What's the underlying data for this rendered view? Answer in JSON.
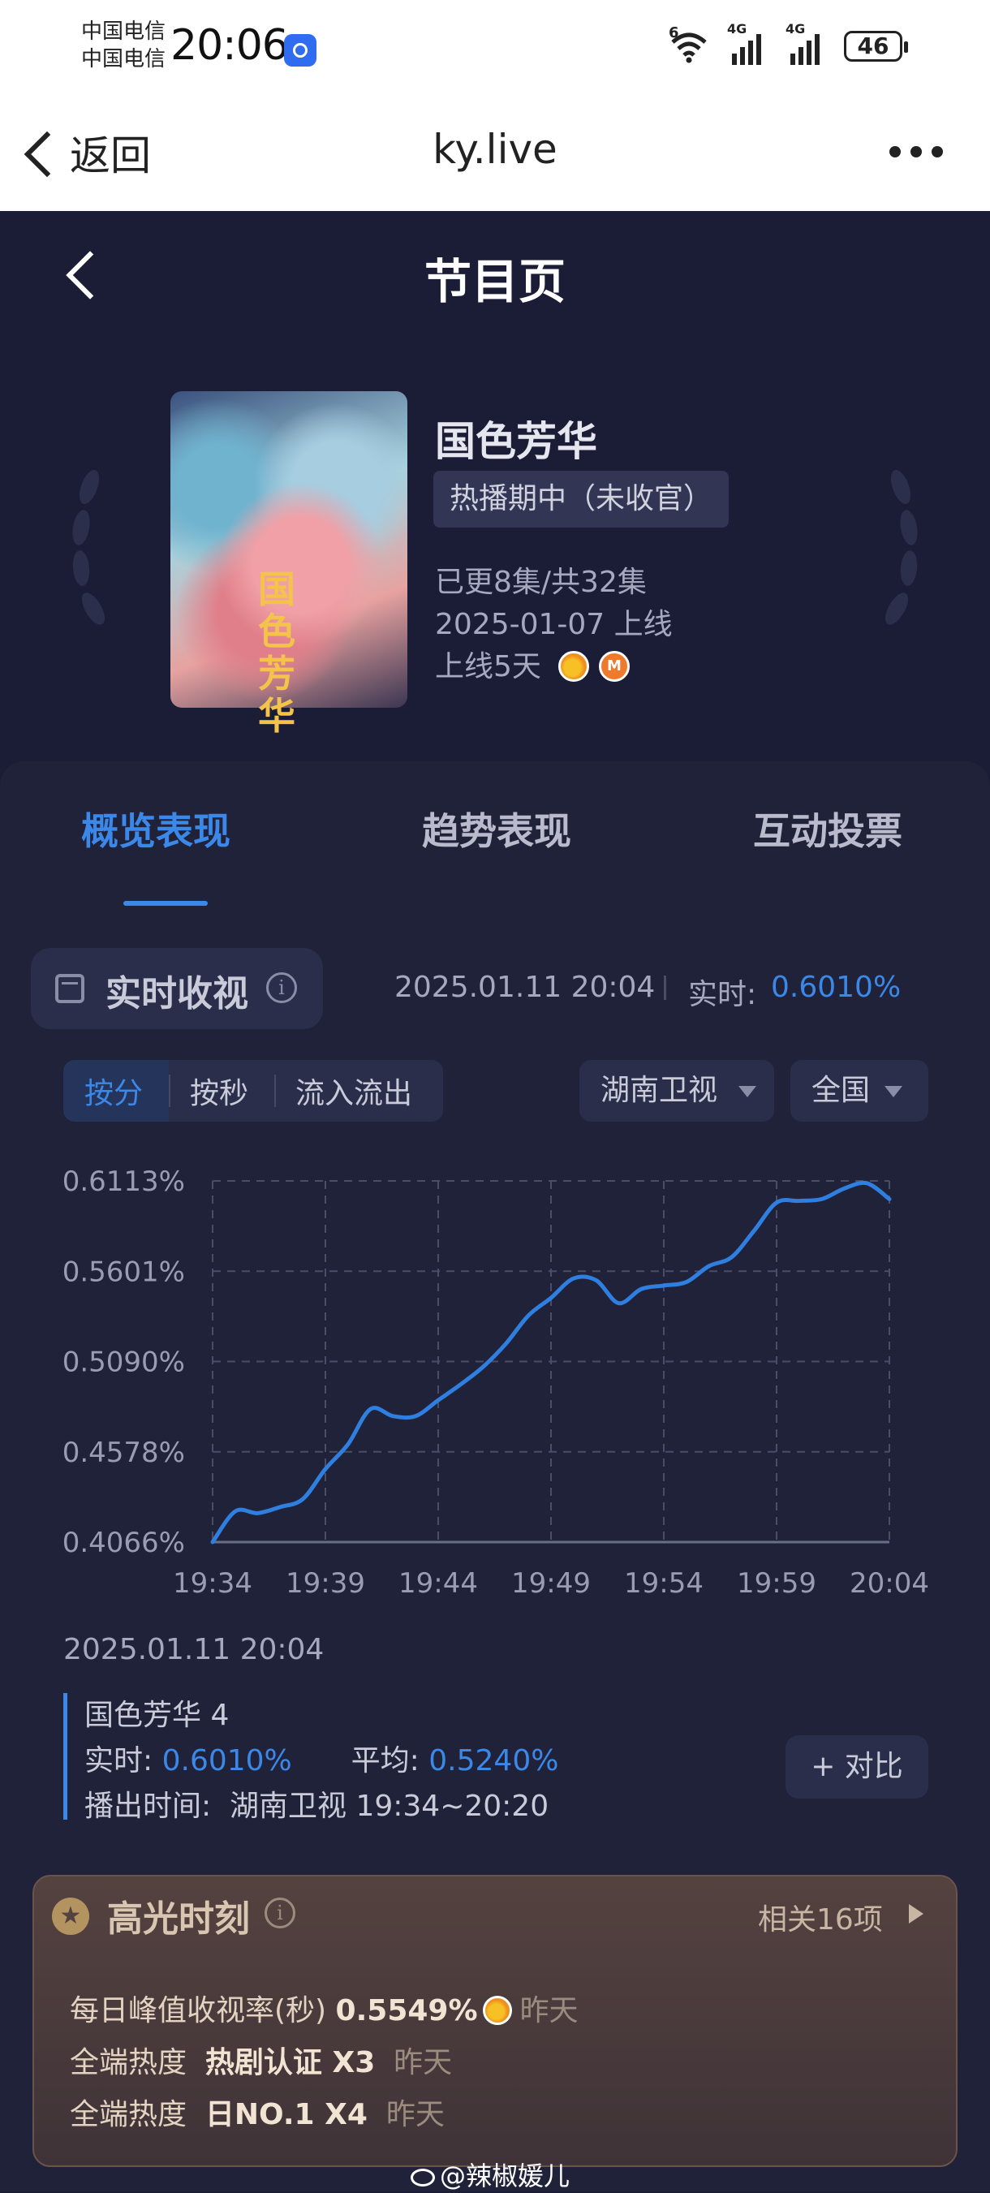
{
  "status_bar": {
    "carrier_1": "中国电信",
    "carrier_2": "中国电信",
    "time": "20:06",
    "signal_labels": [
      "4G",
      "4G"
    ],
    "wifi_label": "6",
    "battery": "46"
  },
  "browser": {
    "back_label": "返回",
    "url": "ky.live"
  },
  "page": {
    "title": "节目页"
  },
  "program": {
    "name": "国色芳华",
    "status_badge": "热播期中（未收官）",
    "episodes": "已更8集/共32集",
    "premiere": "2025-01-07 上线",
    "days_online": "上线5天",
    "poster_text": "国色芳华",
    "channels": [
      "mango-tv-icon",
      "mgtv-icon"
    ]
  },
  "tabs": [
    {
      "label": "概览表现",
      "active": true
    },
    {
      "label": "趋势表现",
      "active": false
    },
    {
      "label": "互动投票",
      "active": false
    }
  ],
  "realtime": {
    "title": "实时收视",
    "timestamp": "2025.01.11 20:04",
    "label": "实时:",
    "value": "0.6010%"
  },
  "segment": {
    "items": [
      "按分",
      "按秒",
      "流入流出"
    ],
    "selected": "按分"
  },
  "filters": {
    "channel": "湖南卫视",
    "region": "全国"
  },
  "chart_data": {
    "type": "line",
    "title": "",
    "xlabel": "",
    "ylabel": "",
    "x_ticks": [
      "19:34",
      "19:39",
      "19:44",
      "19:49",
      "19:54",
      "19:59",
      "20:04"
    ],
    "y_ticks": [
      "0.4066%",
      "0.4578%",
      "0.5090%",
      "0.5601%",
      "0.6113%"
    ],
    "ylim": [
      0.4066,
      0.6113
    ],
    "grid": true,
    "color": "#2f7fe0",
    "series": [
      {
        "minutes": [
          0,
          1,
          2,
          3,
          4,
          5,
          6,
          7,
          8,
          9,
          10,
          11,
          12,
          13,
          14,
          15,
          16,
          17,
          18,
          19,
          20,
          21,
          22,
          23,
          24,
          25,
          26,
          27,
          28,
          29,
          30
        ],
        "values": [
          0.4066,
          0.424,
          0.423,
          0.4265,
          0.431,
          0.448,
          0.462,
          0.482,
          0.478,
          0.478,
          0.487,
          0.496,
          0.506,
          0.519,
          0.535,
          0.545,
          0.556,
          0.555,
          0.542,
          0.55,
          0.552,
          0.554,
          0.563,
          0.568,
          0.583,
          0.599,
          0.6,
          0.601,
          0.607,
          0.61,
          0.601
        ]
      }
    ]
  },
  "snapshot": {
    "date": "2025.01.11 20:04",
    "episode": "国色芳华 4",
    "realtime_label": "实时:",
    "realtime_value": "0.6010%",
    "average_label": "平均:",
    "average_value": "0.5240%",
    "airing": "播出时间:  湖南卫视 19:34~20:20",
    "compare_button": "+ 对比"
  },
  "highlight": {
    "title": "高光时刻",
    "related": "相关16项",
    "rows": [
      {
        "label": "每日峰值收视率(秒)",
        "value": "0.5549%",
        "when": "昨天",
        "icon": "mango-tv-icon"
      },
      {
        "label": "全端热度",
        "value": "热剧认证 X3",
        "when": "昨天"
      },
      {
        "label": "全端热度",
        "value": "日NO.1 X4",
        "when": "昨天"
      }
    ]
  },
  "watermark": "@辣椒媛儿"
}
